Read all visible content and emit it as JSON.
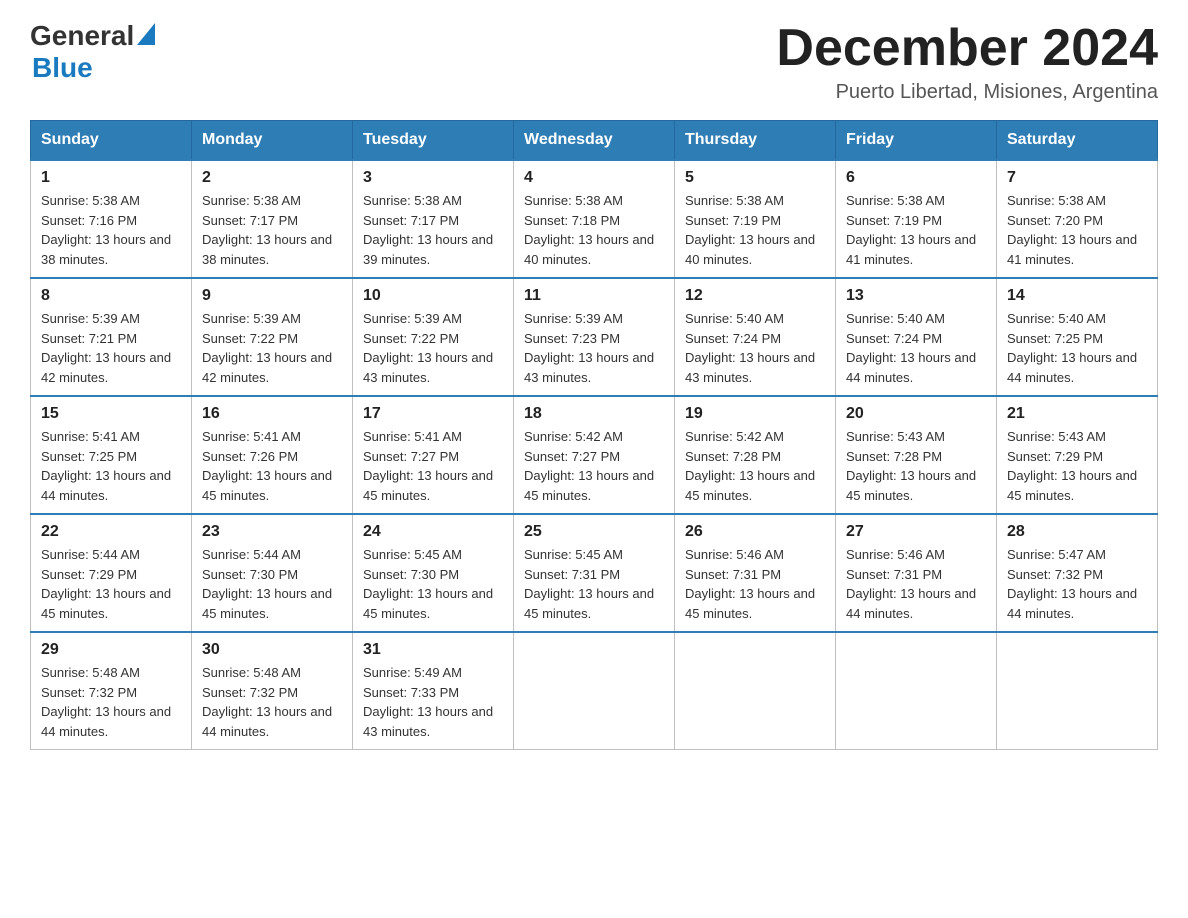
{
  "header": {
    "logo_general": "General",
    "logo_blue": "Blue",
    "title": "December 2024",
    "subtitle": "Puerto Libertad, Misiones, Argentina"
  },
  "calendar": {
    "days_of_week": [
      "Sunday",
      "Monday",
      "Tuesday",
      "Wednesday",
      "Thursday",
      "Friday",
      "Saturday"
    ],
    "weeks": [
      [
        {
          "day": "1",
          "sunrise": "Sunrise: 5:38 AM",
          "sunset": "Sunset: 7:16 PM",
          "daylight": "Daylight: 13 hours and 38 minutes."
        },
        {
          "day": "2",
          "sunrise": "Sunrise: 5:38 AM",
          "sunset": "Sunset: 7:17 PM",
          "daylight": "Daylight: 13 hours and 38 minutes."
        },
        {
          "day": "3",
          "sunrise": "Sunrise: 5:38 AM",
          "sunset": "Sunset: 7:17 PM",
          "daylight": "Daylight: 13 hours and 39 minutes."
        },
        {
          "day": "4",
          "sunrise": "Sunrise: 5:38 AM",
          "sunset": "Sunset: 7:18 PM",
          "daylight": "Daylight: 13 hours and 40 minutes."
        },
        {
          "day": "5",
          "sunrise": "Sunrise: 5:38 AM",
          "sunset": "Sunset: 7:19 PM",
          "daylight": "Daylight: 13 hours and 40 minutes."
        },
        {
          "day": "6",
          "sunrise": "Sunrise: 5:38 AM",
          "sunset": "Sunset: 7:19 PM",
          "daylight": "Daylight: 13 hours and 41 minutes."
        },
        {
          "day": "7",
          "sunrise": "Sunrise: 5:38 AM",
          "sunset": "Sunset: 7:20 PM",
          "daylight": "Daylight: 13 hours and 41 minutes."
        }
      ],
      [
        {
          "day": "8",
          "sunrise": "Sunrise: 5:39 AM",
          "sunset": "Sunset: 7:21 PM",
          "daylight": "Daylight: 13 hours and 42 minutes."
        },
        {
          "day": "9",
          "sunrise": "Sunrise: 5:39 AM",
          "sunset": "Sunset: 7:22 PM",
          "daylight": "Daylight: 13 hours and 42 minutes."
        },
        {
          "day": "10",
          "sunrise": "Sunrise: 5:39 AM",
          "sunset": "Sunset: 7:22 PM",
          "daylight": "Daylight: 13 hours and 43 minutes."
        },
        {
          "day": "11",
          "sunrise": "Sunrise: 5:39 AM",
          "sunset": "Sunset: 7:23 PM",
          "daylight": "Daylight: 13 hours and 43 minutes."
        },
        {
          "day": "12",
          "sunrise": "Sunrise: 5:40 AM",
          "sunset": "Sunset: 7:24 PM",
          "daylight": "Daylight: 13 hours and 43 minutes."
        },
        {
          "day": "13",
          "sunrise": "Sunrise: 5:40 AM",
          "sunset": "Sunset: 7:24 PM",
          "daylight": "Daylight: 13 hours and 44 minutes."
        },
        {
          "day": "14",
          "sunrise": "Sunrise: 5:40 AM",
          "sunset": "Sunset: 7:25 PM",
          "daylight": "Daylight: 13 hours and 44 minutes."
        }
      ],
      [
        {
          "day": "15",
          "sunrise": "Sunrise: 5:41 AM",
          "sunset": "Sunset: 7:25 PM",
          "daylight": "Daylight: 13 hours and 44 minutes."
        },
        {
          "day": "16",
          "sunrise": "Sunrise: 5:41 AM",
          "sunset": "Sunset: 7:26 PM",
          "daylight": "Daylight: 13 hours and 45 minutes."
        },
        {
          "day": "17",
          "sunrise": "Sunrise: 5:41 AM",
          "sunset": "Sunset: 7:27 PM",
          "daylight": "Daylight: 13 hours and 45 minutes."
        },
        {
          "day": "18",
          "sunrise": "Sunrise: 5:42 AM",
          "sunset": "Sunset: 7:27 PM",
          "daylight": "Daylight: 13 hours and 45 minutes."
        },
        {
          "day": "19",
          "sunrise": "Sunrise: 5:42 AM",
          "sunset": "Sunset: 7:28 PM",
          "daylight": "Daylight: 13 hours and 45 minutes."
        },
        {
          "day": "20",
          "sunrise": "Sunrise: 5:43 AM",
          "sunset": "Sunset: 7:28 PM",
          "daylight": "Daylight: 13 hours and 45 minutes."
        },
        {
          "day": "21",
          "sunrise": "Sunrise: 5:43 AM",
          "sunset": "Sunset: 7:29 PM",
          "daylight": "Daylight: 13 hours and 45 minutes."
        }
      ],
      [
        {
          "day": "22",
          "sunrise": "Sunrise: 5:44 AM",
          "sunset": "Sunset: 7:29 PM",
          "daylight": "Daylight: 13 hours and 45 minutes."
        },
        {
          "day": "23",
          "sunrise": "Sunrise: 5:44 AM",
          "sunset": "Sunset: 7:30 PM",
          "daylight": "Daylight: 13 hours and 45 minutes."
        },
        {
          "day": "24",
          "sunrise": "Sunrise: 5:45 AM",
          "sunset": "Sunset: 7:30 PM",
          "daylight": "Daylight: 13 hours and 45 minutes."
        },
        {
          "day": "25",
          "sunrise": "Sunrise: 5:45 AM",
          "sunset": "Sunset: 7:31 PM",
          "daylight": "Daylight: 13 hours and 45 minutes."
        },
        {
          "day": "26",
          "sunrise": "Sunrise: 5:46 AM",
          "sunset": "Sunset: 7:31 PM",
          "daylight": "Daylight: 13 hours and 45 minutes."
        },
        {
          "day": "27",
          "sunrise": "Sunrise: 5:46 AM",
          "sunset": "Sunset: 7:31 PM",
          "daylight": "Daylight: 13 hours and 44 minutes."
        },
        {
          "day": "28",
          "sunrise": "Sunrise: 5:47 AM",
          "sunset": "Sunset: 7:32 PM",
          "daylight": "Daylight: 13 hours and 44 minutes."
        }
      ],
      [
        {
          "day": "29",
          "sunrise": "Sunrise: 5:48 AM",
          "sunset": "Sunset: 7:32 PM",
          "daylight": "Daylight: 13 hours and 44 minutes."
        },
        {
          "day": "30",
          "sunrise": "Sunrise: 5:48 AM",
          "sunset": "Sunset: 7:32 PM",
          "daylight": "Daylight: 13 hours and 44 minutes."
        },
        {
          "day": "31",
          "sunrise": "Sunrise: 5:49 AM",
          "sunset": "Sunset: 7:33 PM",
          "daylight": "Daylight: 13 hours and 43 minutes."
        },
        null,
        null,
        null,
        null
      ]
    ]
  }
}
